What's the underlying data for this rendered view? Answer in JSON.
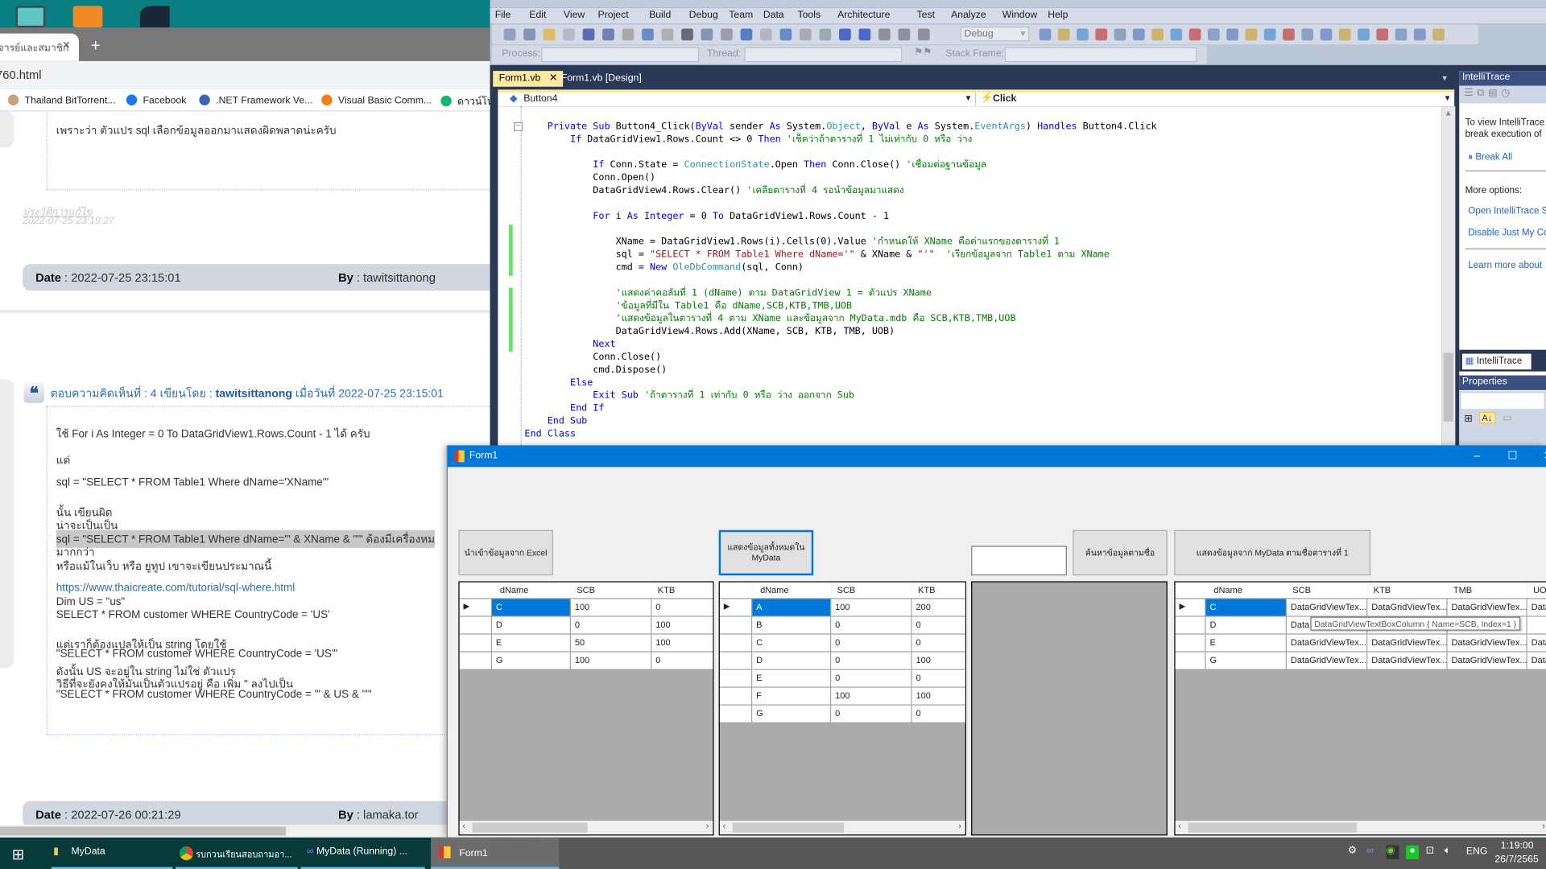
{
  "browser": {
    "tab_title": "จารย์และสมาชิก",
    "url": "760.html",
    "bookmarks": [
      {
        "label": "Thailand BitTorrent...",
        "color": "#c8a27a"
      },
      {
        "label": "Facebook",
        "color": "#1877f2"
      },
      {
        "label": ".NET Framework Ve...",
        "color": "#3763b8"
      },
      {
        "label": "Visual Basic Comm...",
        "color": "#f07e1b"
      },
      {
        "label": "ดาวน์โห",
        "color": "#15b66c"
      }
    ],
    "prev_comment": {
      "line": "เพราะว่า ตัวแปร sql เลือกข้อมูลออกมาแสดงผิดพลาดน่ะครับ",
      "history_label": "ประวัติการแก้ไข",
      "history_date": "2022-07-25 23:19:27",
      "date_label": "Date",
      "date": "2022-07-25 23:15:01",
      "by_label": "By",
      "by": "tawitsittanong"
    },
    "comment": {
      "header_prefix": "ตอบความคิดเห็นที่ : 4 เขียนโดย : ",
      "author": "tawitsittanong",
      "header_suffix": " เมื่อวันที่ 2022-07-25 23:15:01",
      "lines": [
        "ใช้ For i As Integer = 0 To DataGridView1.Rows.Count - 1 ได้ ครับ",
        "",
        "แต่",
        "",
        "sql = \"SELECT * FROM Table1 Where dName='XName'\"",
        "",
        "นั้น เขียนผิด",
        "น่าจะเป็นเป็น",
        "sql = \"SELECT * FROM Table1 Where dName='\" & XName & \"'\" ต้องมีเครื่องหม",
        "มากกว่า",
        "หรือแม้ในเว็บ หรือ ยูทูป เขาจะเขียนประมาณนี้",
        "",
        "https://www.thaicreate.com/tutorial/sql-where.html",
        "Dim US = \"us\"",
        "SELECT * FROM customer WHERE CountryCode = 'US'",
        "",
        "แต่เราก็ต้องแปลให้เป็น string โดยใช้",
        "\"SELECT * FROM customer WHERE CountryCode = 'US'\"",
        "ดังนั้น US จะอยู่ใน string ไม่ใช่ ตัวแปร",
        "วิธีที่จะยังคงให้มันเป็นตัวแปรอยู่ คือ เพิ่ม \" ลงไปเป็น",
        "\"SELECT * FROM customer WHERE CountryCode = '\" & US & \"'\""
      ],
      "highlight_line": 8,
      "link_line": 12,
      "date_label": "Date",
      "date": "2022-07-26 00:21:29",
      "by_label": "By",
      "by": "lamaka.tor"
    }
  },
  "vs": {
    "menu": [
      "File",
      "Edit",
      "View",
      "Project",
      "Build",
      "Debug",
      "Team",
      "Data",
      "Tools",
      "Architecture",
      "Test",
      "Analyze",
      "Window",
      "Help"
    ],
    "config": "Debug",
    "debug_bar": {
      "process": "Process:",
      "thread": "Thread:",
      "stack_frame": "Stack Frame:"
    },
    "tabs": [
      {
        "label": "Form1.vb",
        "active": true
      },
      {
        "label": "Form1.vb [Design]",
        "active": false
      }
    ],
    "nav_object": "Button4",
    "nav_event": "Click",
    "code": [
      [
        [
          "kw",
          "    Private Sub"
        ],
        [
          "t",
          " Button4_Click("
        ],
        [
          "kw",
          "ByVal"
        ],
        [
          "t",
          " sender "
        ],
        [
          "kw",
          "As"
        ],
        [
          "t",
          " System."
        ],
        [
          "ty",
          "Object"
        ],
        [
          "t",
          ", "
        ],
        [
          "kw",
          "ByVal"
        ],
        [
          "t",
          " e "
        ],
        [
          "kw",
          "As"
        ],
        [
          "t",
          " System."
        ],
        [
          "ty",
          "EventArgs"
        ],
        [
          "t",
          ") "
        ],
        [
          "kw",
          "Handles"
        ],
        [
          "t",
          " Button4.Click"
        ]
      ],
      [
        [
          "kw",
          "        If"
        ],
        [
          "t",
          " DataGridView1.Rows.Count <> 0 "
        ],
        [
          "kw",
          "Then"
        ],
        [
          "cm",
          " 'เช็คว่าถ้าตารางที่ 1 ไม่เท่ากับ 0 หรือ ว่าง"
        ]
      ],
      [],
      [
        [
          "kw",
          "            If"
        ],
        [
          "t",
          " Conn.State = "
        ],
        [
          "ty",
          "ConnectionState"
        ],
        [
          "t",
          ".Open "
        ],
        [
          "kw",
          "Then"
        ],
        [
          "t",
          " Conn.Close() "
        ],
        [
          "cm",
          "'เชื่อมต่อฐานข้อมูล"
        ]
      ],
      [
        [
          "t",
          "            Conn.Open()"
        ]
      ],
      [
        [
          "t",
          "            DataGridView4.Rows.Clear() "
        ],
        [
          "cm",
          "'เคลียตารางที่ 4 รอนำข้อมูลมาแสดง"
        ]
      ],
      [],
      [
        [
          "kw",
          "            For"
        ],
        [
          "t",
          " i "
        ],
        [
          "kw",
          "As Integer"
        ],
        [
          "t",
          " = 0 "
        ],
        [
          "kw",
          "To"
        ],
        [
          "t",
          " DataGridView1.Rows.Count - 1"
        ]
      ],
      [],
      [
        [
          "t",
          "                XName = DataGridView1.Rows(i).Cells(0).Value "
        ],
        [
          "cm",
          "'กำหนดให้ XName คือค่าแรกของตารางที่ 1"
        ]
      ],
      [
        [
          "t",
          "                sql = "
        ],
        [
          "st",
          "\"SELECT * FROM Table1 Where dName='\""
        ],
        [
          "t",
          " & XName & "
        ],
        [
          "st",
          "\"'\""
        ],
        [
          "cm",
          "  'เรียกข้อมูลจาก Table1 ตาม XName"
        ]
      ],
      [
        [
          "t",
          "                cmd = "
        ],
        [
          "kw",
          "New"
        ],
        [
          "t",
          " "
        ],
        [
          "ty",
          "OleDbCommand"
        ],
        [
          "t",
          "(sql, Conn)"
        ]
      ],
      [],
      [
        [
          "cm",
          "                'แสดงค่าคอลัมที่ 1 (dName) ตาม DataGridView 1 = ตัวแปร XName"
        ]
      ],
      [
        [
          "cm",
          "                'ข้อมูลที่มีใน Table1 คือ dName,SCB,KTB,TMB,UOB"
        ]
      ],
      [
        [
          "cm",
          "                'แสดงข้อมูลในตารางที่ 4 ตาม XName และข้อมูลจาก MyData.mdb คือ SCB,KTB,TMB,UOB"
        ]
      ],
      [
        [
          "t",
          "                DataGridView4.Rows.Add(XName, SCB, KTB, TMB, UOB)"
        ]
      ],
      [
        [
          "kw",
          "            Next"
        ]
      ],
      [
        [
          "t",
          "            Conn.Close()"
        ]
      ],
      [
        [
          "t",
          "            cmd.Dispose()"
        ]
      ],
      [
        [
          "kw",
          "        Else"
        ]
      ],
      [
        [
          "kw",
          "            Exit Sub"
        ],
        [
          "cm",
          " 'ถ้าตารางที่ 1 เท่ากับ 0 หรือ ว่าง ออกจาก Sub"
        ]
      ],
      [
        [
          "kw",
          "        End If"
        ]
      ],
      [
        [
          "kw",
          "    End Sub"
        ]
      ],
      [
        [
          "kw",
          "End Class"
        ]
      ]
    ],
    "intellitrace": {
      "title": "IntelliTrace",
      "line1": "To view IntelliTrace",
      "line2": "break execution of",
      "break_all": "Break All",
      "more": "More options:",
      "open": "Open IntelliTrace S",
      "disable": "Disable Just My Co",
      "learn": "Learn more about",
      "tab": "IntelliTrace",
      "properties": "Properties"
    }
  },
  "form1": {
    "title": "Form1",
    "buttons": {
      "import_excel": "นำเข้าข้อมูลจาก Excel",
      "show_all": "แสดงข้อมูลทั้งหมดใน MyData",
      "search": "ค้นหาข้อมูลตามชื่อ",
      "show_by_table1": "แสดงข้อมูลจาก MyData ตามชื่อตารางที่ 1"
    },
    "search_value": "",
    "grid1": {
      "columns": [
        "dName",
        "SCB",
        "KTB"
      ],
      "rows": [
        [
          "C",
          "100",
          "0"
        ],
        [
          "D",
          "0",
          "100"
        ],
        [
          "E",
          "50",
          "100"
        ],
        [
          "G",
          "100",
          "0"
        ]
      ]
    },
    "grid2": {
      "columns": [
        "dName",
        "SCB",
        "KTB"
      ],
      "rows": [
        [
          "A",
          "100",
          "200"
        ],
        [
          "B",
          "0",
          "0"
        ],
        [
          "C",
          "0",
          "0"
        ],
        [
          "D",
          "0",
          "100"
        ],
        [
          "E",
          "0",
          "0"
        ],
        [
          "F",
          "100",
          "100"
        ],
        [
          "G",
          "0",
          "0"
        ]
      ]
    },
    "grid4": {
      "columns": [
        "dName",
        "SCB",
        "KTB",
        "TMB",
        "UOB"
      ],
      "rows": [
        [
          "C",
          "DataGridViewTex...",
          "DataGridViewTex...",
          "DataGridViewTex...",
          "Data"
        ],
        [
          "D",
          "Data",
          "",
          "",
          ""
        ],
        [
          "E",
          "DataGridViewTex...",
          "DataGridViewTex...",
          "DataGridViewTex...",
          "Data"
        ],
        [
          "G",
          "DataGridViewTex...",
          "DataGridViewTex...",
          "DataGridViewTex...",
          "Data"
        ]
      ]
    },
    "tooltip": "DataGridViewTextBoxColumn { Name=SCB, Index=1 }",
    "selection_color": "#0078d7"
  },
  "taskbar": {
    "items": [
      {
        "label": "MyData",
        "icon": "folder-icon"
      },
      {
        "label": "รบกวนเรียนสอบถามอา...",
        "icon": "chrome-icon"
      },
      {
        "label": "MyData (Running) ...",
        "icon": "visual-studio-icon"
      },
      {
        "label": "Form1",
        "icon": "form-icon"
      }
    ],
    "lang": "ENG",
    "time": "1:19:00",
    "date": "26/7/2565"
  }
}
